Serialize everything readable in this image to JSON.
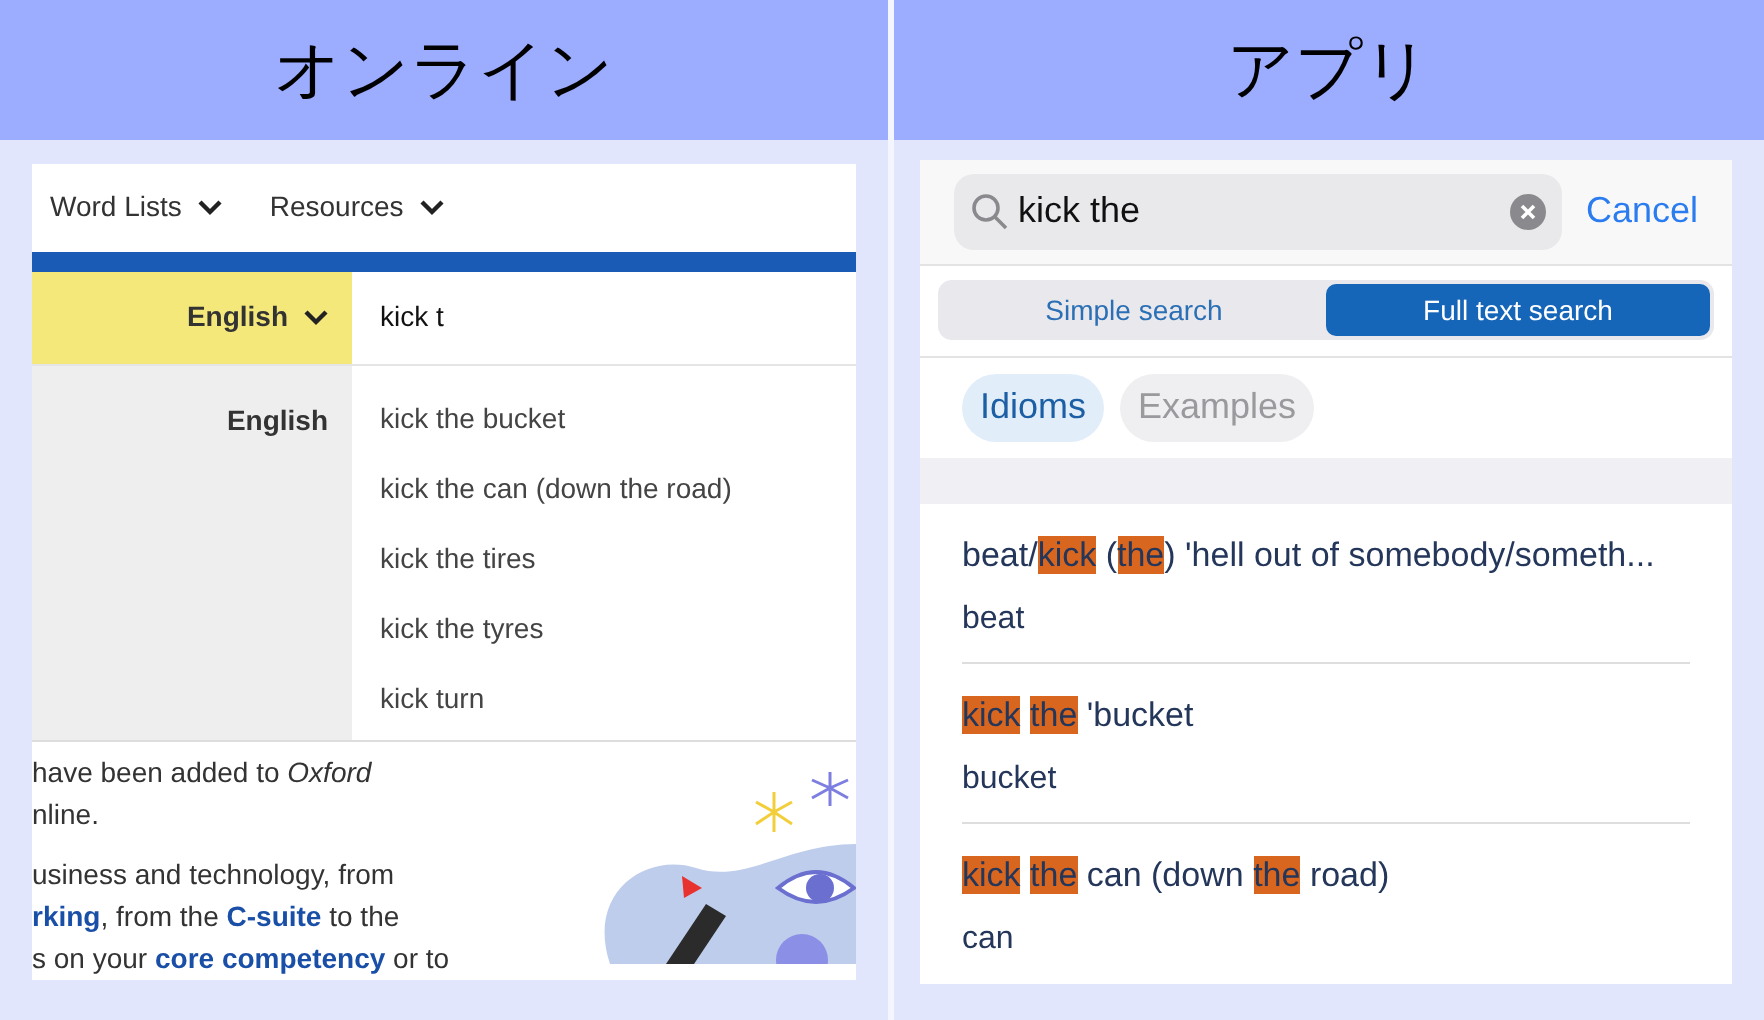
{
  "panels": [
    {
      "heading": "オンライン"
    },
    {
      "heading": "アプリ"
    }
  ],
  "online": {
    "nav": [
      {
        "label": "Word Lists"
      },
      {
        "label": "Resources"
      }
    ],
    "language": "English",
    "query": "kick t",
    "suggestion_group": "English",
    "suggestions": [
      "kick the bucket",
      "kick the can (down the road)",
      "kick the tires",
      "kick the tyres",
      "kick turn"
    ],
    "paragraphs": [
      [
        [
          {
            "kind": "text",
            "text": "have been added to *Oxford*"
          }
        ],
        [
          {
            "kind": "text",
            "text": "nline."
          }
        ]
      ],
      [
        [
          {
            "kind": "text",
            "text": "usiness and technology, from"
          }
        ],
        [
          {
            "kind": "link",
            "text": "rking"
          },
          {
            "kind": "text",
            "text": ", from the "
          },
          {
            "kind": "link",
            "text": "C-suite"
          },
          {
            "kind": "text",
            "text": " to the"
          }
        ],
        [
          {
            "kind": "text",
            "text": "s on your "
          },
          {
            "kind": "link",
            "text": "core competency"
          },
          {
            "kind": "text",
            "text": " or to"
          }
        ]
      ]
    ]
  },
  "app": {
    "query": "kick the",
    "cancel": "Cancel",
    "modes": [
      {
        "label": "Simple search",
        "selected": false
      },
      {
        "label": "Full text search",
        "selected": true
      }
    ],
    "filters": [
      {
        "label": "Idioms",
        "selected": true
      },
      {
        "label": "Examples",
        "selected": false
      }
    ],
    "results": [
      {
        "title_words": [
          [
            {
              "text": "beat/",
              "highlighted": false
            },
            {
              "text": "kick",
              "highlighted": true
            }
          ],
          [
            {
              "text": "(",
              "highlighted": false
            },
            {
              "text": "the",
              "highlighted": true
            },
            {
              "text": ")",
              "highlighted": false
            }
          ],
          [
            {
              "text": "'hell out of somebody/someth...",
              "highlighted": false
            }
          ]
        ],
        "headword": "beat"
      },
      {
        "title_words": [
          [
            {
              "text": "kick",
              "highlighted": true
            }
          ],
          [
            {
              "text": "the",
              "highlighted": true
            }
          ],
          [
            {
              "text": "'bucket",
              "highlighted": false
            }
          ]
        ],
        "headword": "bucket"
      },
      {
        "title_words": [
          [
            {
              "text": "kick",
              "highlighted": true
            }
          ],
          [
            {
              "text": "the",
              "highlighted": true
            }
          ],
          [
            {
              "text": "can (down",
              "highlighted": false
            }
          ],
          [
            {
              "text": "the",
              "highlighted": true
            }
          ],
          [
            {
              "text": "road)",
              "highlighted": false
            }
          ]
        ],
        "headword": "can"
      }
    ]
  }
}
